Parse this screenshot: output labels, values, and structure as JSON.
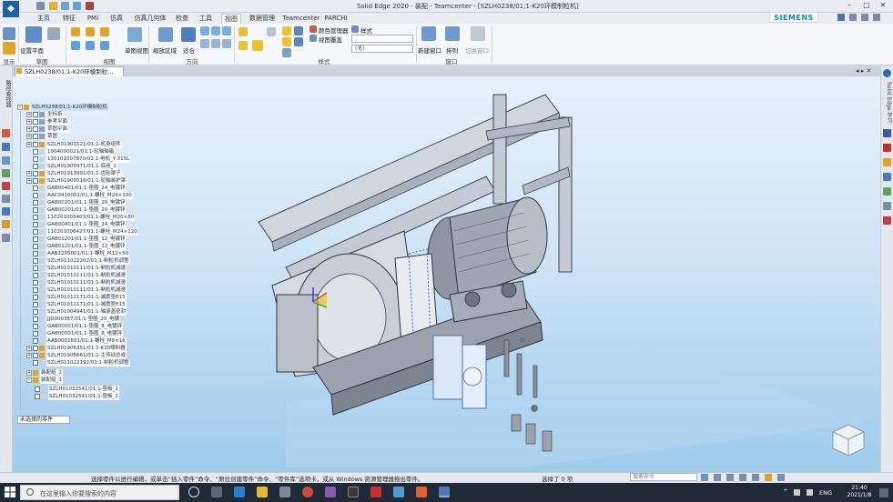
{
  "window": {
    "title": "Solid Edge 2020 - 装配 - Teamcenter - [SZLH0238/01;1-K20环模制粒机]",
    "brand": "SIEMENS"
  },
  "tabs": [
    {
      "label": "主页"
    },
    {
      "label": "特征"
    },
    {
      "label": "PMI"
    },
    {
      "label": "仿真"
    },
    {
      "label": "仿真几何体"
    },
    {
      "label": "检查"
    },
    {
      "label": "工具"
    },
    {
      "label": "视图",
      "active": true
    },
    {
      "label": "数据管理"
    },
    {
      "label": "Teamcenter"
    },
    {
      "label": "PARCHI"
    }
  ],
  "ribbon": {
    "buttons": {
      "set_plane": "设置平面",
      "single_view": "单图视图",
      "zoom_area": "缩放区域",
      "fit": "适合",
      "color_manager": "颜色管理器",
      "view_overlay": "视图覆盖",
      "styles": "样式",
      "none_value": "(无)",
      "new_window": "新建窗口",
      "arrange": "排列",
      "switch_window": "切换窗口"
    },
    "groups": {
      "show": "显示",
      "sketch": "草图",
      "views": "视图",
      "orient": "方向",
      "style": "样式",
      "window": "窗口"
    }
  },
  "document_tab": "SZLH0238/01;1-K20环模制粒...",
  "side_labels": {
    "left": "路径查找器",
    "right": "Solid Edge 学习"
  },
  "tree": {
    "root": "SZLH0238/01;1-K20环模制粒机",
    "items": [
      {
        "label": "坐标系",
        "icon": "folder"
      },
      {
        "label": "参考平面",
        "icon": "folder"
      },
      {
        "label": "草图平面",
        "icon": "folder"
      },
      {
        "label": "草图",
        "icon": "folder"
      },
      {
        "label": "SZLH01901521/01;1-机身组件",
        "icon": "asm"
      },
      {
        "label": "1904000021/01;1-轮轴轴箱",
        "icon": "part"
      },
      {
        "label": "130101007870/01;1-电机_Y-315L",
        "icon": "part"
      },
      {
        "label": "SZLH01900971/01;1-底座_1",
        "icon": "part"
      },
      {
        "label": "SZLH01913991/01;1-齿轮罩子",
        "icon": "asm"
      },
      {
        "label": "SZLH01900516/01;1-轮轴装护罩",
        "icon": "asm"
      },
      {
        "label": "GAB00401/01;1-垫圈_24_电镀锌",
        "icon": "part"
      },
      {
        "label": "AAC0410001/01;1-螺栓_M24×100",
        "icon": "part"
      },
      {
        "label": "GAB00201/01;1-垫圈_20_电镀锌",
        "icon": "part"
      },
      {
        "label": "GAB00201/01;1-垫圈_20_电镀锌",
        "icon": "part"
      },
      {
        "label": "110201003403/01;1-螺栓_M20×80",
        "icon": "part"
      },
      {
        "label": "GAB00401/01;1-垫圈_24_电镀锌",
        "icon": "part"
      },
      {
        "label": "110201000427/01;1-螺栓_M24×120",
        "icon": "part"
      },
      {
        "label": "GAB01201/01;1-垫圈_12_电镀锌",
        "icon": "part"
      },
      {
        "label": "GAB01201/01;1-垫圈_12_电镀锌",
        "icon": "part"
      },
      {
        "label": "AAB1205001/01;1-螺栓_M12×50",
        "icon": "part"
      },
      {
        "label": "SZLH011022202/01;1-制粒机调整",
        "icon": "part"
      },
      {
        "label": "SZLH01010111/01;1-制粒机减速",
        "icon": "part"
      },
      {
        "label": "SZLH01010111/01;1-制粒机减速",
        "icon": "part"
      },
      {
        "label": "SZLH01010111/01;1-制粒机减速",
        "icon": "part"
      },
      {
        "label": "SZLH01010111/01;1-制粒机减速",
        "icon": "part"
      },
      {
        "label": "SZLH01012171/01;1-减震垫E15",
        "icon": "part"
      },
      {
        "label": "SZLH01012171/01;1-减震垫E15",
        "icon": "part"
      },
      {
        "label": "SZLH01004941/01;1-轴承盖密封",
        "icon": "part"
      },
      {
        "label": "JJD000367/01;1-垫圈_20_电镀",
        "icon": "part"
      },
      {
        "label": "GAB00001/01;1-垫圈_8_电镀锌",
        "icon": "part"
      },
      {
        "label": "GAB00001/01;1-垫圈_8_电镀锌",
        "icon": "part"
      },
      {
        "label": "AAB0001601/01;1-螺栓_M8×16",
        "icon": "part"
      },
      {
        "label": "SZLH01906351/01;1-K20喂料器",
        "icon": "asm"
      },
      {
        "label": "SZLH01905661/01;1-主传动总成",
        "icon": "asm"
      },
      {
        "label": "SZLH011022192/01;1-制粒机调整",
        "icon": "part"
      },
      {
        "label": "装配组_2",
        "icon": "folder"
      },
      {
        "label": "装配组_3",
        "icon": "folder"
      },
      {
        "label": "SZLH01032541/01;1-垫板_1",
        "icon": "part"
      },
      {
        "label": "SZLH01032541/01;1-垫板_2",
        "icon": "part"
      }
    ],
    "filter": "未选择的零件"
  },
  "status": {
    "message": "选择零件以进行编辑，或单击“插入零件”命令、“原位创建零件”命令、“零件库”选项卡，或从 Windows 资源管理器拖出零件。",
    "selected": "选择了 0 项",
    "command_finder": "搜索命令"
  },
  "taskbar": {
    "search_placeholder": "在这里输入你要搜索的内容",
    "lang": "ENG",
    "time": "21:40",
    "date": "2021/1/8"
  },
  "colors": {
    "accent": "#1d5fa8",
    "brand": "#0a8c96",
    "viewport_top": "#e6f1fb",
    "viewport_bottom": "#9fcbed"
  }
}
